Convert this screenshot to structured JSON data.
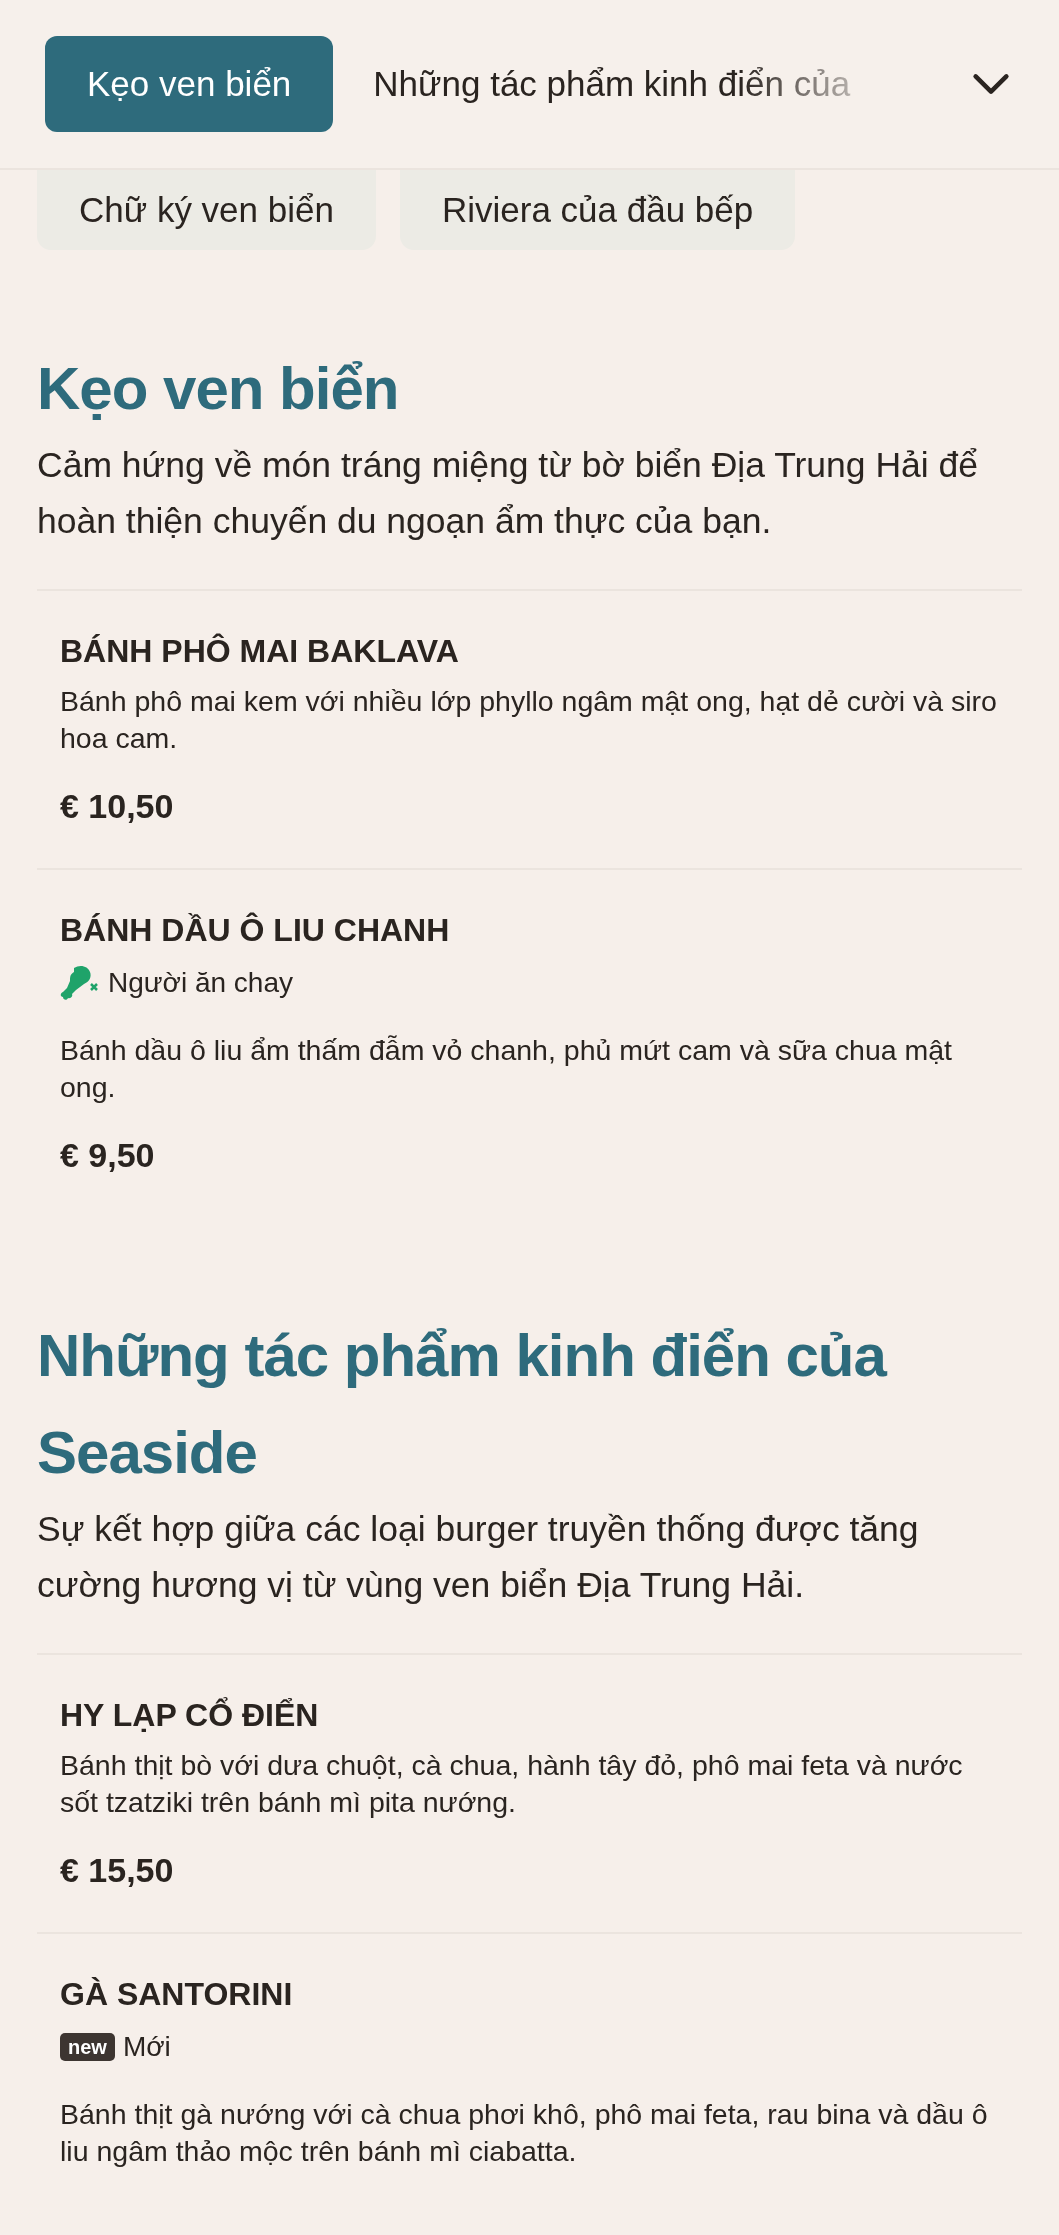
{
  "header_tabs": [
    {
      "label": "Kẹo ven biển",
      "selected": true
    },
    {
      "label": "Những tác phẩm kinh điển của",
      "selected": false
    }
  ],
  "more_tabs": [
    {
      "label": "Chữ ký ven biển",
      "selected": false
    },
    {
      "label": "Riviera của đầu bếp",
      "selected": false
    }
  ],
  "sections": [
    {
      "title": "Kẹo ven biển",
      "description": "Cảm hứng về món tráng miệng từ bờ biển Địa Trung Hải để hoàn thiện chuyến du ngoạn ẩm thực của bạn.",
      "items": [
        {
          "name": "BÁNH PHÔ MAI BAKLAVA",
          "description": "Bánh phô mai kem với nhiều lớp phyllo ngâm mật ong, hạt dẻ cười và siro hoa cam.",
          "price": "€ 10,50"
        },
        {
          "name": "BÁNH DẦU Ô LIU CHANH",
          "tags": [
            {
              "kind": "vegetarian",
              "label": "Người ăn chay"
            }
          ],
          "description": "Bánh dầu ô liu ẩm thấm đẫm vỏ chanh, phủ mứt cam và sữa chua mật ong.",
          "price": "€ 9,50"
        }
      ]
    },
    {
      "title": "Những tác phẩm kinh điển của Seaside",
      "description": "Sự kết hợp giữa các loại burger truyền thống được tăng cường hương vị từ vùng ven biển Địa Trung Hải.",
      "items": [
        {
          "name": "HY LẠP CỔ ĐIỂN",
          "description": "Bánh thịt bò với dưa chuột, cà chua, hành tây đỏ, phô mai feta và nước sốt tzatziki trên bánh mì pita nướng.",
          "price": "€ 15,50"
        },
        {
          "name": "GÀ SANTORINI",
          "tags": [
            {
              "kind": "new",
              "badge": "new",
              "label": "Mới"
            }
          ],
          "description": "Bánh thịt gà nướng với cà chua phơi khô, phô mai feta, rau bina và dầu ô liu ngâm thảo mộc trên bánh mì ciabatta."
        }
      ]
    }
  ]
}
